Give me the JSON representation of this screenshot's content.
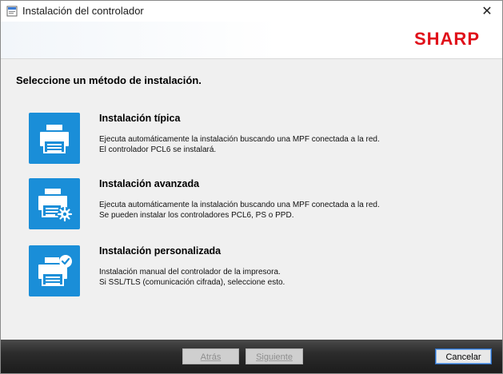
{
  "window": {
    "title": "Instalación del controlador",
    "close_glyph": "✕"
  },
  "banner": {
    "logo_text": "SHARP",
    "logo_color": "#e0101a"
  },
  "heading": "Seleccione un método de instalación.",
  "options": [
    {
      "title": "Instalación típica",
      "desc_line1": "Ejecuta automáticamente la instalación buscando una MPF conectada a la red.",
      "desc_line2": "El controlador PCL6 se instalará.",
      "icon": "printer-icon"
    },
    {
      "title": "Instalación avanzada",
      "desc_line1": "Ejecuta automáticamente la instalación buscando una MPF conectada a la red.",
      "desc_line2": "Se pueden instalar los controladores PCL6, PS o PPD.",
      "icon": "printer-gear-icon"
    },
    {
      "title": "Instalación personalizada",
      "desc_line1": "Instalación manual del controlador de la impresora.",
      "desc_line2": "Si SSL/TLS (comunicación cifrada), seleccione esto.",
      "icon": "printer-check-icon"
    }
  ],
  "buttons": {
    "back": "Atrás",
    "next": "Siguiente",
    "cancel": "Cancelar"
  },
  "colors": {
    "accent": "#1a8ed8",
    "footer": "#2c2c2c"
  }
}
